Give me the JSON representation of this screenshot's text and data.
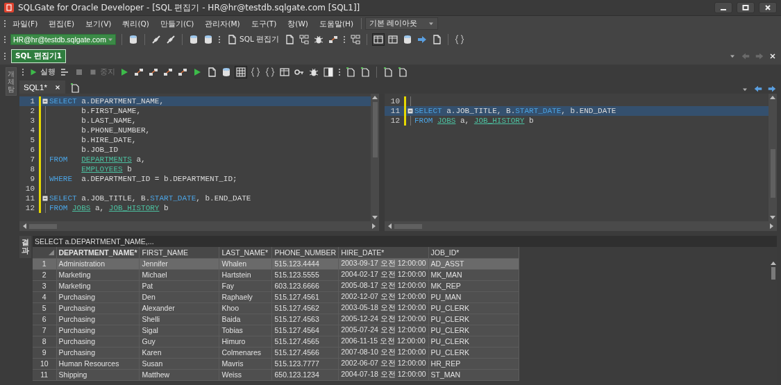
{
  "window": {
    "title": "SQLGate for Oracle Developer - [SQL 편집기 - HR@hr@testdb.sqlgate.com [SQL1]]"
  },
  "menu": [
    "파일(F)",
    "편집(E)",
    "보기(V)",
    "쿼리(Q)",
    "만들기(C)",
    "관리자(M)",
    "도구(T)",
    "창(W)",
    "도움말(H)"
  ],
  "layout_dropdown": {
    "value": "기본 레이아웃"
  },
  "connection": {
    "value": "HR@hr@testdb.sqlgate.com"
  },
  "toolbar": {
    "sql_editor_label": "SQL 편집기"
  },
  "editor_tabs": [
    {
      "label": "SQL 편집기1",
      "selected": true
    }
  ],
  "side_panel": {
    "label": "개체 탐"
  },
  "editor_toolbar": [
    {
      "label": "실행",
      "disabled": false
    },
    {
      "label": "중지",
      "disabled": true
    }
  ],
  "doc_tabs": [
    {
      "label": "SQL1*",
      "selected": true
    }
  ],
  "editors": [
    {
      "lines": [
        {
          "number": "1",
          "current": true,
          "fold": true,
          "modified": true,
          "tokens": [
            {
              "kind": "keyword",
              "text": "SELECT"
            },
            {
              "kind": "plain",
              "text": " a.DEPARTMENT_NAME,"
            }
          ]
        },
        {
          "number": "2",
          "current": false,
          "fold": false,
          "modified": true,
          "tokens": [
            {
              "kind": "plain",
              "text": "       b.FIRST_NAME,"
            }
          ]
        },
        {
          "number": "3",
          "current": false,
          "fold": false,
          "modified": true,
          "tokens": [
            {
              "kind": "plain",
              "text": "       b.LAST_NAME,"
            }
          ]
        },
        {
          "number": "4",
          "current": false,
          "fold": false,
          "modified": true,
          "tokens": [
            {
              "kind": "plain",
              "text": "       b.PHONE_NUMBER,"
            }
          ]
        },
        {
          "number": "5",
          "current": false,
          "fold": false,
          "modified": true,
          "tokens": [
            {
              "kind": "plain",
              "text": "       b.HIRE_DATE,"
            }
          ]
        },
        {
          "number": "6",
          "current": false,
          "fold": false,
          "modified": true,
          "tokens": [
            {
              "kind": "plain",
              "text": "       b.JOB_ID"
            }
          ]
        },
        {
          "number": "7",
          "current": false,
          "fold": false,
          "modified": true,
          "tokens": [
            {
              "kind": "keyword",
              "text": "FROM"
            },
            {
              "kind": "table",
              "text": "   DEPARTMENTS"
            },
            {
              "kind": "plain",
              "text": " a,"
            }
          ]
        },
        {
          "number": "8",
          "current": false,
          "fold": false,
          "modified": true,
          "tokens": [
            {
              "kind": "table",
              "text": "       EMPLOYEES"
            },
            {
              "kind": "plain",
              "text": " b"
            }
          ]
        },
        {
          "number": "9",
          "current": false,
          "fold": false,
          "modified": true,
          "tokens": [
            {
              "kind": "keyword",
              "text": "WHERE"
            },
            {
              "kind": "plain",
              "text": "  a.DEPARTMENT_ID = b.DEPARTMENT_ID;"
            }
          ]
        },
        {
          "number": "10",
          "current": false,
          "fold": false,
          "modified": true
        },
        {
          "number": "11",
          "current": false,
          "fold": true,
          "modified": true,
          "tokens": [
            {
              "kind": "keyword",
              "text": "SELECT"
            },
            {
              "kind": "plain",
              "text": " a.JOB_TITLE, B."
            },
            {
              "kind": "keyword",
              "text": "START_DATE"
            },
            {
              "kind": "plain",
              "text": ", b.END_DATE"
            }
          ]
        },
        {
          "number": "12",
          "current": false,
          "fold": false,
          "modified": true,
          "tokens": [
            {
              "kind": "keyword",
              "text": "FROM"
            },
            {
              "kind": "table",
              "text": " JOBS"
            },
            {
              "kind": "plain",
              "text": " a,"
            },
            {
              "kind": "table",
              "text": " JOB_HISTORY"
            },
            {
              "kind": "plain",
              "text": " b"
            }
          ]
        }
      ]
    },
    {
      "lines": [
        {
          "number": "10",
          "current": false,
          "fold": false,
          "modified": true
        },
        {
          "number": "11",
          "current": true,
          "fold": true,
          "modified": true,
          "tokens": [
            {
              "kind": "keyword",
              "text": "SELECT"
            },
            {
              "kind": "plain",
              "text": " a.JOB_TITLE, B."
            },
            {
              "kind": "keyword",
              "text": "START_DATE"
            },
            {
              "kind": "plain",
              "text": ", b.END_DATE"
            }
          ]
        },
        {
          "number": "12",
          "current": false,
          "fold": false,
          "modified": true,
          "tokens": [
            {
              "kind": "keyword",
              "text": "FROM"
            },
            {
              "kind": "table",
              "text": " JOBS"
            },
            {
              "kind": "plain",
              "text": " a,"
            },
            {
              "kind": "table",
              "text": " JOB_HISTORY"
            },
            {
              "kind": "plain",
              "text": " b"
            }
          ]
        }
      ]
    }
  ],
  "results": {
    "label": "결과",
    "query": "SELECT a.DEPARTMENT_NAME,...",
    "columns": [
      "DEPARTMENT_NAME*",
      "FIRST_NAME",
      "LAST_NAME*",
      "PHONE_NUMBER",
      "HIRE_DATE*",
      "JOB_ID*"
    ],
    "rows": [
      {
        "number": "1",
        "selected": true,
        "cells": [
          "Administration",
          "Jennifer",
          "Whalen",
          "515.123.4444",
          "2003-09-17 오전 12:00:00",
          "AD_ASST"
        ]
      },
      {
        "number": "2",
        "selected": false,
        "cells": [
          "Marketing",
          "Michael",
          "Hartstein",
          "515.123.5555",
          "2004-02-17 오전 12:00:00",
          "MK_MAN"
        ]
      },
      {
        "number": "3",
        "selected": false,
        "cells": [
          "Marketing",
          "Pat",
          "Fay",
          "603.123.6666",
          "2005-08-17 오전 12:00:00",
          "MK_REP"
        ]
      },
      {
        "number": "4",
        "selected": false,
        "cells": [
          "Purchasing",
          "Den",
          "Raphaely",
          "515.127.4561",
          "2002-12-07 오전 12:00:00",
          "PU_MAN"
        ]
      },
      {
        "number": "5",
        "selected": false,
        "cells": [
          "Purchasing",
          "Alexander",
          "Khoo",
          "515.127.4562",
          "2003-05-18 오전 12:00:00",
          "PU_CLERK"
        ]
      },
      {
        "number": "6",
        "selected": false,
        "cells": [
          "Purchasing",
          "Shelli",
          "Baida",
          "515.127.4563",
          "2005-12-24 오전 12:00:00",
          "PU_CLERK"
        ]
      },
      {
        "number": "7",
        "selected": false,
        "cells": [
          "Purchasing",
          "Sigal",
          "Tobias",
          "515.127.4564",
          "2005-07-24 오전 12:00:00",
          "PU_CLERK"
        ]
      },
      {
        "number": "8",
        "selected": false,
        "cells": [
          "Purchasing",
          "Guy",
          "Himuro",
          "515.127.4565",
          "2006-11-15 오전 12:00:00",
          "PU_CLERK"
        ]
      },
      {
        "number": "9",
        "selected": false,
        "cells": [
          "Purchasing",
          "Karen",
          "Colmenares",
          "515.127.4566",
          "2007-08-10 오전 12:00:00",
          "PU_CLERK"
        ]
      },
      {
        "number": "10",
        "selected": false,
        "cells": [
          "Human Resources",
          "Susan",
          "Mavris",
          "515.123.7777",
          "2002-06-07 오전 12:00:00",
          "HR_REP"
        ]
      },
      {
        "number": "11",
        "selected": false,
        "cells": [
          "Shipping",
          "Matthew",
          "Weiss",
          "650.123.1234",
          "2004-07-18 오전 12:00:00",
          "ST_MAN"
        ]
      }
    ]
  }
}
